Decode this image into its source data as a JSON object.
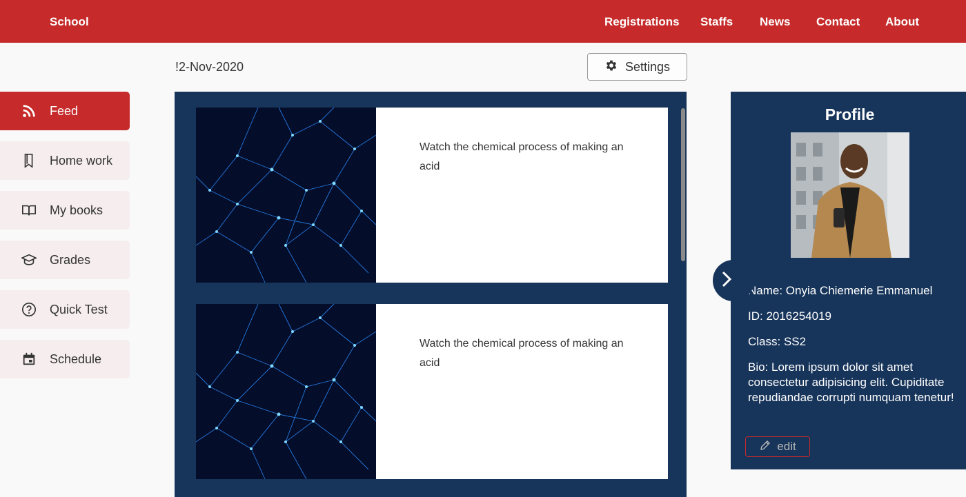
{
  "header": {
    "brand": "School",
    "nav": [
      "Registrations",
      "Staffs",
      "News",
      "Contact",
      "About"
    ]
  },
  "toolbar": {
    "date": "!2-Nov-2020",
    "settings_label": "Settings"
  },
  "sidebar": {
    "items": [
      {
        "label": "Feed",
        "icon": "rss-icon",
        "active": true
      },
      {
        "label": "Home work",
        "icon": "bookmark-icon",
        "active": false
      },
      {
        "label": "My books",
        "icon": "open-book-icon",
        "active": false
      },
      {
        "label": "Grades",
        "icon": "graduation-cap-icon",
        "active": false
      },
      {
        "label": "Quick Test",
        "icon": "question-circle-icon",
        "active": false
      },
      {
        "label": "Schedule",
        "icon": "calendar-icon",
        "active": false
      }
    ]
  },
  "feed": {
    "items": [
      {
        "text": "Watch the chemical process of making an acid"
      },
      {
        "text": "Watch the chemical process of making an acid"
      }
    ]
  },
  "profile": {
    "title": "Profile",
    "name": "Name:  Onyia Chiemerie Emmanuel",
    "id": "ID:  2016254019",
    "class": "Class:  SS2",
    "bio": "Bio: Lorem ipsum dolor sit amet consectetur adipisicing elit. Cupiditate repudiandae corrupti numquam tenetur!",
    "edit_label": "edit"
  },
  "colors": {
    "brand_red": "#c62a2a",
    "panel_navy": "#17345a",
    "sidebar_bg": "#f6eeee"
  }
}
